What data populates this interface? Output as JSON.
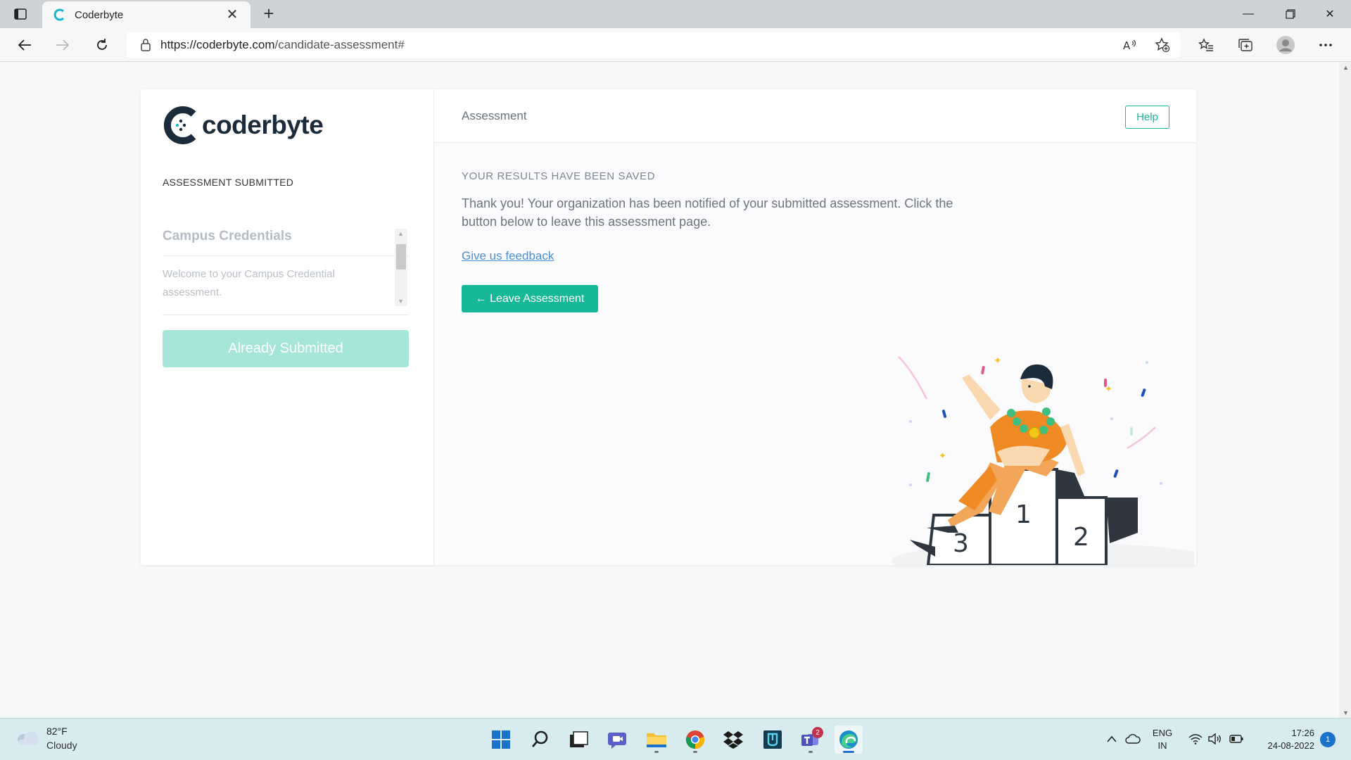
{
  "browser": {
    "tab_title": "Coderbyte",
    "url_host": "https://coderbyte.com",
    "url_path": "/candidate-assessment#"
  },
  "sidebar": {
    "logo_text": "coderbyte",
    "status": "ASSESSMENT SUBMITTED",
    "section_title": "Campus Credentials",
    "section_desc": "Welcome to your Campus Credential assessment.",
    "submitted_button": "Already Submitted"
  },
  "main": {
    "header_title": "Assessment",
    "help_button": "Help",
    "saved_label": "YOUR RESULTS HAVE BEEN SAVED",
    "thanks_text": "Thank you! Your organization has been notified of your submitted assessment. Click the button below to leave this assessment page.",
    "feedback_link": "Give us feedback",
    "leave_button": "← Leave Assessment",
    "podium": {
      "first": "1",
      "second": "2",
      "third": "3"
    }
  },
  "taskbar": {
    "weather_temp": "82°F",
    "weather_desc": "Cloudy",
    "teams_badge": "2",
    "lang_top": "ENG",
    "lang_bottom": "IN",
    "time": "17:26",
    "date": "24-08-2022",
    "notification_count": "1"
  },
  "colors": {
    "accent": "#17b897",
    "accent_disabled": "#a6e6d9",
    "link": "#4a8fd1",
    "brand_dark": "#1b2b3a"
  }
}
